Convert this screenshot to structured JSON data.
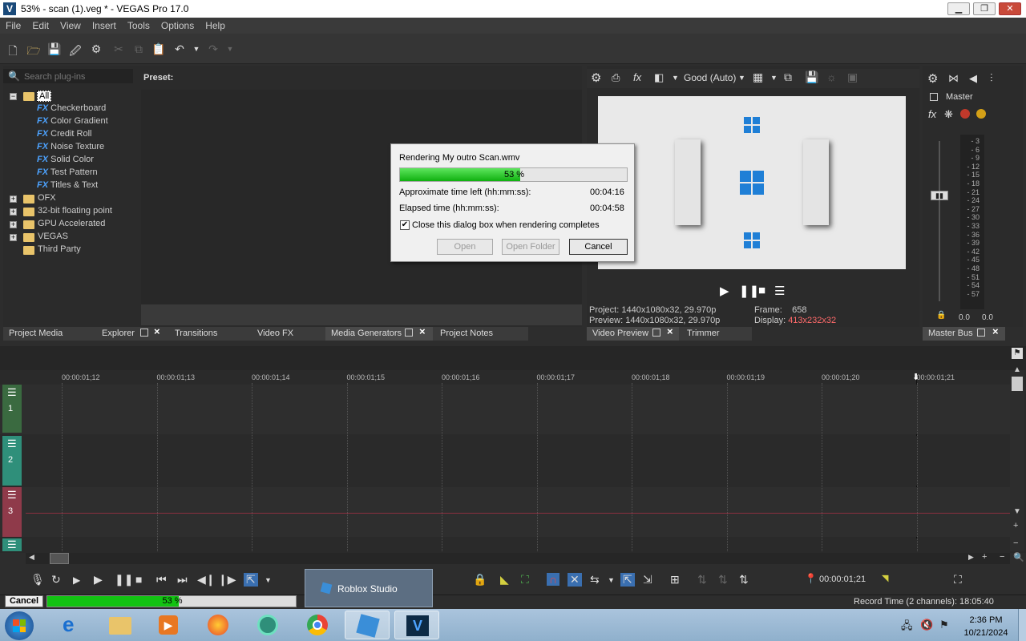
{
  "window": {
    "title": "53% - scan (1).veg * - VEGAS Pro 17.0",
    "icon": "V"
  },
  "menu": [
    "File",
    "Edit",
    "View",
    "Insert",
    "Tools",
    "Options",
    "Help"
  ],
  "plugins": {
    "search_placeholder": "Search plug-ins",
    "preset_label": "Preset:",
    "tree_root": "All",
    "generators": [
      "Checkerboard",
      "Color Gradient",
      "Credit Roll",
      "Noise Texture",
      "Solid Color",
      "Test Pattern",
      "Titles & Text"
    ],
    "fx_badge": "FX",
    "folders": [
      "OFX",
      "32-bit floating point",
      "GPU Accelerated",
      "VEGAS",
      "Third Party"
    ]
  },
  "left_tabs": {
    "project_media": "Project Media",
    "explorer": "Explorer",
    "transitions": "Transitions",
    "video_fx": "Video FX",
    "media_generators": "Media Generators",
    "project_notes": "Project Notes"
  },
  "preview": {
    "quality": "Good (Auto)",
    "project_label": "Project:",
    "project_value": "1440x1080x32, 29.970p",
    "preview_label": "Preview:",
    "preview_value": "1440x1080x32, 29.970p",
    "frame_label": "Frame:",
    "frame_value": "658",
    "display_label": "Display:",
    "display_value": "413x232x32",
    "tab_video_preview": "Video Preview",
    "tab_trimmer": "Trimmer"
  },
  "master": {
    "label": "Master",
    "meter_labels": [
      "3",
      "6",
      "9",
      "12",
      "15",
      "18",
      "21",
      "24",
      "27",
      "30",
      "33",
      "36",
      "39",
      "42",
      "45",
      "48",
      "51",
      "54",
      "57"
    ],
    "level_left": "0.0",
    "level_right": "0.0",
    "tab_master_bus": "Master Bus"
  },
  "timeline": {
    "ruler": [
      "00:00:01;12",
      "00:00:01;13",
      "00:00:01;14",
      "00:00:01;15",
      "00:00:01;16",
      "00:00:01;17",
      "00:00:01;18",
      "00:00:01;19",
      "00:00:01;20",
      "00:00:01;21"
    ],
    "tracks": [
      "1",
      "2",
      "3"
    ],
    "cursor_time": "00:00:01;21"
  },
  "status": {
    "cancel": "Cancel",
    "progress_text": "53 %",
    "progress": 0.53,
    "record_time": "Record Time (2 channels): 18:05:40"
  },
  "render_dialog": {
    "title": "Rendering My outro Scan.wmv",
    "progress_text": "53 %",
    "progress": 0.53,
    "time_left_label": "Approximate time left (hh:mm:ss):",
    "time_left_value": "00:04:16",
    "elapsed_label": "Elapsed time (hh:mm:ss):",
    "elapsed_value": "00:04:58",
    "close_checkbox_label": "Close this dialog box when rendering completes",
    "open": "Open",
    "open_folder": "Open Folder",
    "cancel": "Cancel"
  },
  "taskbar": {
    "popup": "Roblox Studio",
    "time": "2:36 PM",
    "date": "10/21/2024"
  },
  "colors": {
    "accent_green": "#12c312",
    "vegas_blue": "#1f7fd6",
    "track2": "#2f8f7a",
    "track3": "#8f3a4a",
    "track1": "#3a6a40"
  }
}
